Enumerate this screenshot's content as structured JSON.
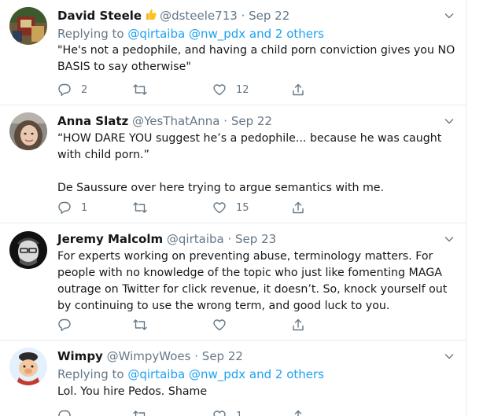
{
  "tweets": [
    {
      "name": "David Steele",
      "badge_icon": "thumbs-up-emoji-icon",
      "handle": "@dsteele713",
      "date": "Sep 22",
      "replying_to": {
        "prefix": "Replying to",
        "users": "@qirtaiba @nw_pdx",
        "suffix": "and 2 others"
      },
      "text": "\"He's not a pedophile, and having a child porn conviction gives you NO BASIS to say otherwise\"",
      "reply_count": "2",
      "retweet_count": "",
      "like_count": "12"
    },
    {
      "name": "Anna Slatz",
      "handle": "@YesThatAnna",
      "date": "Sep 22",
      "text_1": "“HOW DARE YOU suggest he’s a pedophile... because he was caught with child porn.”",
      "text_2": "De Saussure over here trying to argue semantics with me.",
      "reply_count": "1",
      "retweet_count": "",
      "like_count": "15"
    },
    {
      "name": "Jeremy Malcolm",
      "handle": "@qirtaiba",
      "date": "Sep 23",
      "text": "For experts working on preventing abuse, terminology matters. For people with no knowledge of the topic who just like fomenting MAGA outrage on Twitter for click revenue, it doesn’t. So, knock yourself out by continuing to use the wrong term, and good luck to you.",
      "reply_count": "",
      "retweet_count": "",
      "like_count": ""
    },
    {
      "name": "Wimpy",
      "handle": "@WimpyWoes",
      "date": "Sep 22",
      "replying_to": {
        "prefix": "Replying to",
        "users": "@qirtaiba @nw_pdx",
        "suffix": "and 2 others"
      },
      "text": "Lol. You hire Pedos. Shame",
      "reply_count": "",
      "retweet_count": "",
      "like_count": "1"
    }
  ],
  "colors": {
    "name": "#14171a",
    "meta": "#657786",
    "link": "#1da1f2",
    "divider": "#e6ecf0"
  }
}
